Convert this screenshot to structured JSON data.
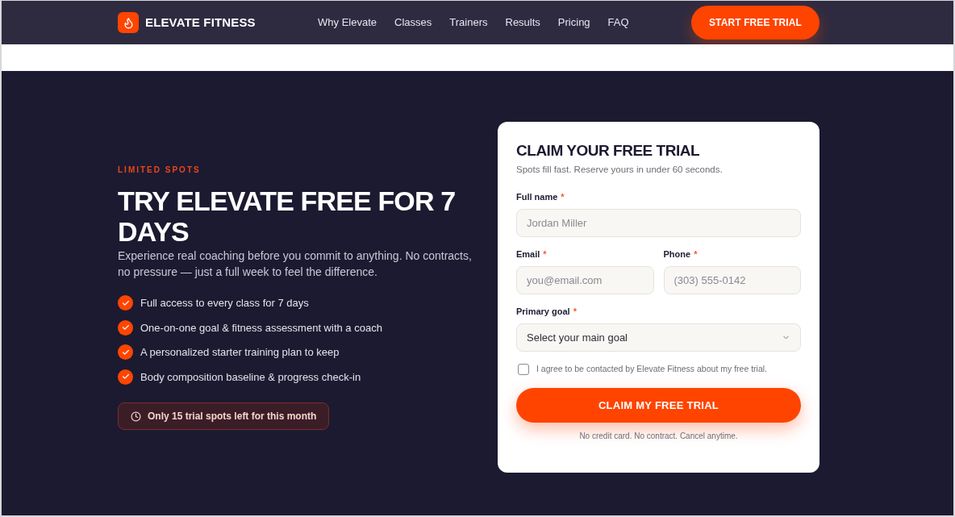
{
  "nav": {
    "brand": "ELEVATE FITNESS",
    "links": [
      "Why Elevate",
      "Classes",
      "Trainers",
      "Results",
      "Pricing",
      "FAQ"
    ],
    "cta": "START FREE TRIAL"
  },
  "hero": {
    "eyebrow": "LIMITED SPOTS",
    "title": "TRY ELEVATE FREE FOR 7 DAYS",
    "description": "Experience real coaching before you commit to anything. No contracts, no pressure — just a full week to feel the difference.",
    "benefits": [
      "Full access to every class for 7 days",
      "One-on-one goal & fitness assessment with a coach",
      "A personalized starter training plan to keep",
      "Body composition baseline & progress check-in"
    ],
    "notice": "Only 15 trial spots left for this month"
  },
  "form": {
    "title": "CLAIM YOUR FREE TRIAL",
    "subtitle": "Spots fill fast. Reserve yours in under 60 seconds.",
    "rows": [
      {
        "fields": [
          {
            "kind": "text",
            "label": "Full name",
            "mark": "*",
            "placeholder": "Jordan Miller"
          }
        ]
      },
      {
        "fields": [
          {
            "kind": "text",
            "label": "Email",
            "mark": "*",
            "placeholder": "you@email.com"
          },
          {
            "kind": "text",
            "label": "Phone",
            "mark": "*",
            "placeholder": "(303) 555-0142"
          }
        ]
      },
      {
        "fields": [
          {
            "kind": "select",
            "label": "Primary goal",
            "mark": "*",
            "value": "Select your main goal"
          }
        ]
      }
    ],
    "consent": {
      "label": "I agree to be contacted by Elevate Fitness about my free trial.",
      "checked": false
    },
    "submit": "CLAIM MY FREE TRIAL",
    "note": "No credit card. No contract. Cancel anytime."
  }
}
